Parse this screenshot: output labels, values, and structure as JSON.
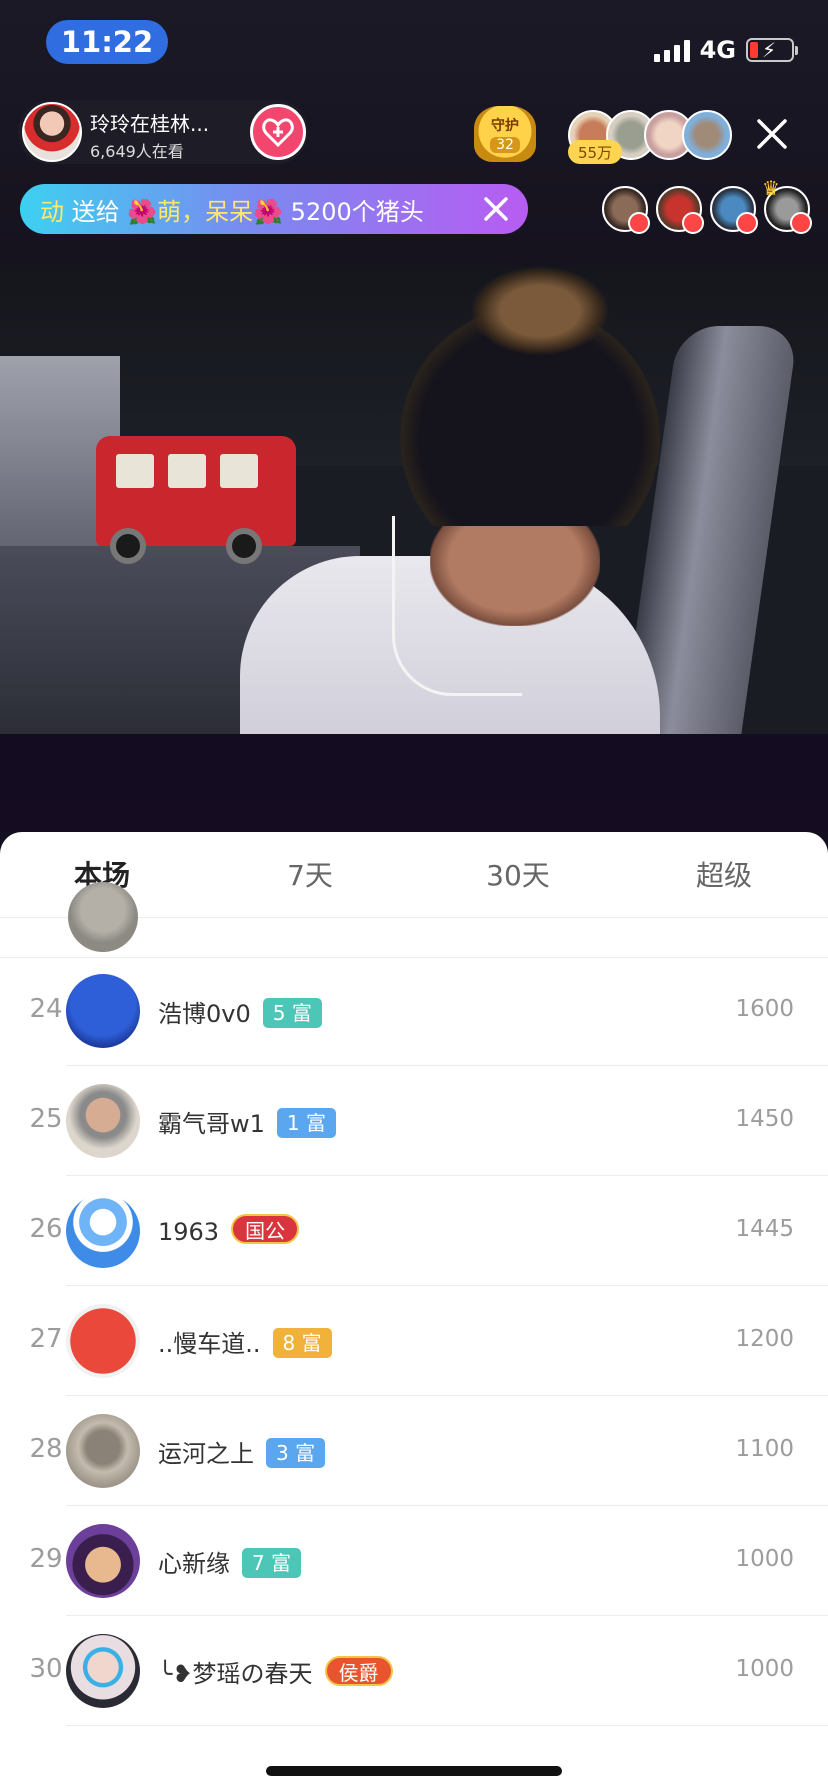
{
  "status_bar": {
    "time": "11:22",
    "network": "4G",
    "battery_level": 0.15,
    "battery_charging": true
  },
  "live_header": {
    "host_name": "玲玲在桂林...",
    "viewer_count": "6,649人在看",
    "guard_label": "守护",
    "guard_count": "32",
    "fan_value": "55万",
    "follow_icon": "heart-plus-icon",
    "close_icon": "close-icon"
  },
  "gift_banner": {
    "prefix": "动",
    "send_to": " 送给 ",
    "recipient": "萌，呆呆",
    "gift": " 5200个猪头",
    "close_icon": "close-icon"
  },
  "ranking": {
    "tabs": [
      "本场",
      "7天",
      "30天",
      "超级"
    ],
    "active_tab": 0,
    "rows": [
      {
        "rank": "24",
        "name": "浩博0v0",
        "badge": "5 富",
        "badge_color": "#4cc6b6",
        "score": "1600",
        "avatar_color": "#2351c7"
      },
      {
        "rank": "25",
        "name": "霸气哥w1",
        "badge": "1 富",
        "badge_color": "#5aa7ef",
        "score": "1450",
        "avatar_color": "#c9b8a4"
      },
      {
        "rank": "26",
        "name": "1963",
        "badge": "国公",
        "badge_color": "#d8353f",
        "score": "1445",
        "avatar_color": "#4a9df0"
      },
      {
        "rank": "27",
        "name": "..慢车道..",
        "badge": "8 富",
        "badge_color": "#f0b23a",
        "score": "1200",
        "avatar_color": "#e9483a"
      },
      {
        "rank": "28",
        "name": "运河之上",
        "badge": "3 富",
        "badge_color": "#5aa7ef",
        "score": "1100",
        "avatar_color": "#b3a79a"
      },
      {
        "rank": "29",
        "name": "心新缘",
        "badge": "7 富",
        "badge_color": "#4cc6b6",
        "score": "1000",
        "avatar_color": "#5b2f7f"
      },
      {
        "rank": "30",
        "name": "╰❥梦瑶の春天",
        "badge": "侯爵",
        "badge_color": "#e8542e",
        "score": "1000",
        "avatar_color": "#d9dbe4"
      }
    ]
  }
}
